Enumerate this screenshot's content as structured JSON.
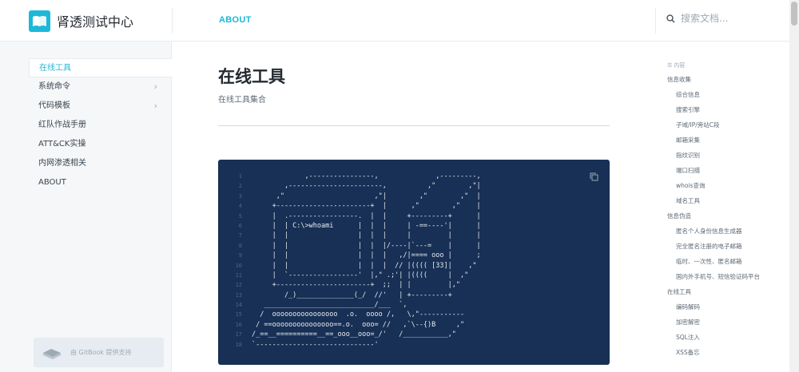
{
  "header": {
    "brand_title": "肾透测试中心",
    "nav_link": "ABOUT",
    "search_placeholder": "搜索文档..."
  },
  "sidebar": {
    "items": [
      {
        "label": "在线工具",
        "active": true,
        "chevron": false
      },
      {
        "label": "系统命令",
        "active": false,
        "chevron": true
      },
      {
        "label": "代码模板",
        "active": false,
        "chevron": true
      },
      {
        "label": "红队作战手册",
        "active": false,
        "chevron": false
      },
      {
        "label": "ATT&CK实操",
        "active": false,
        "chevron": false
      },
      {
        "label": "内网渗透相关",
        "active": false,
        "chevron": false
      },
      {
        "label": "ABOUT",
        "active": false,
        "chevron": false
      }
    ],
    "gitbook": "由 GitBook 提供支持"
  },
  "main": {
    "title": "在线工具",
    "description": "在线工具集合",
    "code_lines": [
      {
        "n": "1",
        "t": "             ,----------------,              ,---------,"
      },
      {
        "n": "2",
        "t": "        ,-----------------------,          ,\"        ,\"|"
      },
      {
        "n": "3",
        "t": "      ,\"                      ,\"|        ,\"        ,\"  |"
      },
      {
        "n": "4",
        "t": "     +-----------------------+  |      ,\"        ,\"    |"
      },
      {
        "n": "5",
        "t": "     |  .-----------------.  |  |     +---------+      |"
      },
      {
        "n": "6",
        "t": "     |  | C:\\>whoami      |  |  |     | -==----'|      |"
      },
      {
        "n": "7",
        "t": "     |  |                 |  |  |     |         |      |"
      },
      {
        "n": "8",
        "t": "     |  |                 |  |  |/----|`---=    |      |"
      },
      {
        "n": "9",
        "t": "     |  |                 |  |  |   ,/|==== ooo |      ;"
      },
      {
        "n": "10",
        "t": "     |  |                 |  |  |  // |(((( [33]|    ,\""
      },
      {
        "n": "11",
        "t": "     |  `-----------------'  |,\" .;'| |((((     |  ,\""
      },
      {
        "n": "12",
        "t": "     +-----------------------+  ;;  | |         |,\""
      },
      {
        "n": "13",
        "t": "        /_)______________(_/  //'   | +---------+"
      },
      {
        "n": "14",
        "t": "   ___________________________/___  `,"
      },
      {
        "n": "15",
        "t": "  /  oooooooooooooooo  .o.  oooo /,   \\,\"-----------"
      },
      {
        "n": "16",
        "t": " / ==ooooooooooooooo==.o.  ooo= //   ,`\\--{)B     ,\""
      },
      {
        "n": "17",
        "t": "/_==__==========__==_ooo__ooo=_/'   /___________,\""
      },
      {
        "n": "18",
        "t": "`-----------------------------'"
      }
    ]
  },
  "toc": {
    "head": "内容",
    "items": [
      {
        "label": "信息收集",
        "level": 1
      },
      {
        "label": "综合信息",
        "level": 2
      },
      {
        "label": "搜索引擎",
        "level": 2
      },
      {
        "label": "子域/IP/旁站C段",
        "level": 2
      },
      {
        "label": "邮箱采集",
        "level": 2
      },
      {
        "label": "指纹识别",
        "level": 2
      },
      {
        "label": "端口扫描",
        "level": 2
      },
      {
        "label": "whois查询",
        "level": 2
      },
      {
        "label": "域名工具",
        "level": 2
      },
      {
        "label": "信息伪造",
        "level": 1
      },
      {
        "label": "匿名个人身份信息生成器",
        "level": 2
      },
      {
        "label": "完全匿名注册的电子邮箱",
        "level": 2
      },
      {
        "label": "临时、一次性、匿名邮箱",
        "level": 2
      },
      {
        "label": "国内外手机号、短信验证码平台",
        "level": 2
      },
      {
        "label": "在线工具",
        "level": 1
      },
      {
        "label": "编码解码",
        "level": 2
      },
      {
        "label": "加密解密",
        "level": 2
      },
      {
        "label": "SQL注入",
        "level": 2
      },
      {
        "label": "XSS备忘",
        "level": 2
      }
    ]
  },
  "colors": {
    "accent": "#1cb8d8",
    "code_bg": "#183055"
  },
  "icons": {
    "logo": "book-icon",
    "search": "search-icon",
    "copy": "copy-icon",
    "gitbook": "gitbook-icon"
  }
}
